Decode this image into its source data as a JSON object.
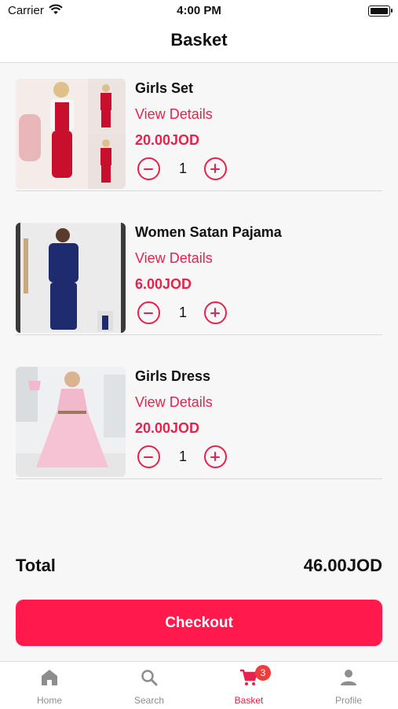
{
  "status": {
    "carrier": "Carrier",
    "time": "4:00 PM"
  },
  "header": {
    "title": "Basket"
  },
  "items": [
    {
      "name": "Girls Set",
      "details_label": "View Details",
      "price": "20.00JOD",
      "quantity": "1"
    },
    {
      "name": "Women Satan Pajama",
      "details_label": "View Details",
      "price": "6.00JOD",
      "quantity": "1"
    },
    {
      "name": "Girls Dress",
      "details_label": "View Details",
      "price": "20.00JOD",
      "quantity": "1"
    }
  ],
  "summary": {
    "total_label": "Total",
    "total_value": "46.00JOD"
  },
  "checkout_label": "Checkout",
  "tabbar": {
    "tabs": [
      {
        "label": "Home",
        "icon": "home-icon"
      },
      {
        "label": "Search",
        "icon": "search-icon"
      },
      {
        "label": "Basket",
        "icon": "cart-icon",
        "badge": "3"
      },
      {
        "label": "Profile",
        "icon": "profile-icon"
      }
    ]
  },
  "colors": {
    "accent": "#e8224d",
    "checkout_bg": "#ff1a4b",
    "badge": "#f23b3b",
    "background": "#f7f7f7",
    "tab_inactive": "#8e8e8e"
  }
}
